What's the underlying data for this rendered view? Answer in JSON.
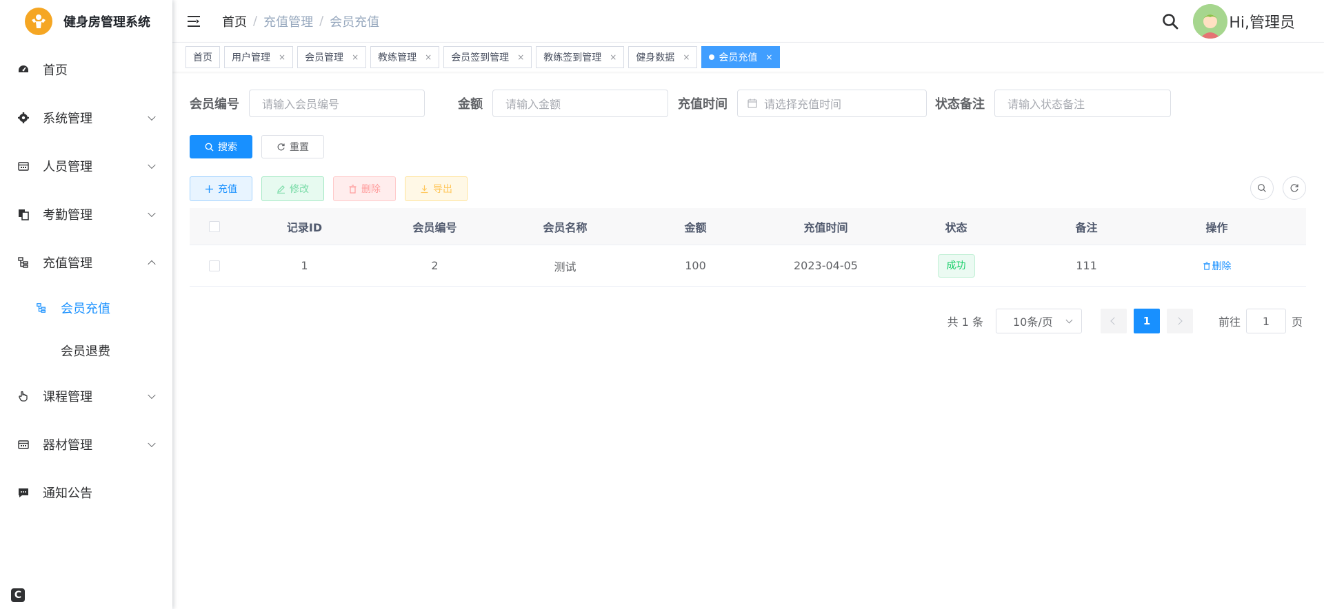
{
  "app": {
    "title": "健身房管理系统"
  },
  "sidebar": {
    "items": [
      {
        "label": "首页",
        "icon": "dashboard-icon"
      },
      {
        "label": "系统管理",
        "icon": "gear-icon"
      },
      {
        "label": "人员管理",
        "icon": "calendar-icon"
      },
      {
        "label": "考勤管理",
        "icon": "copy-icon"
      },
      {
        "label": "充值管理",
        "icon": "tree-icon",
        "expanded": true,
        "children": [
          {
            "label": "会员充值",
            "active": true
          },
          {
            "label": "会员退费"
          }
        ]
      },
      {
        "label": "课程管理",
        "icon": "hand-icon"
      },
      {
        "label": "器材管理",
        "icon": "calendar-icon"
      },
      {
        "label": "通知公告",
        "icon": "message-icon"
      }
    ]
  },
  "header": {
    "breadcrumb": [
      "首页",
      "充值管理",
      "会员充值"
    ],
    "breadcrumb_sep": "/",
    "greeting": "Hi,管理员"
  },
  "tags": [
    {
      "label": "首页",
      "closable": false
    },
    {
      "label": "用户管理",
      "closable": true
    },
    {
      "label": "会员管理",
      "closable": true
    },
    {
      "label": "教练管理",
      "closable": true
    },
    {
      "label": "会员签到管理",
      "closable": true
    },
    {
      "label": "教练签到管理",
      "closable": true
    },
    {
      "label": "健身数据",
      "closable": true
    },
    {
      "label": "会员充值",
      "closable": true,
      "active": true
    }
  ],
  "search": {
    "member_id_label": "会员编号",
    "member_id_placeholder": "请输入会员编号",
    "amount_label": "金额",
    "amount_placeholder": "请输入金额",
    "time_label": "充值时间",
    "time_placeholder": "请选择充值时间",
    "remark_label": "状态备注",
    "remark_placeholder": "请输入状态备注",
    "search_btn": "搜索",
    "reset_btn": "重置"
  },
  "toolbar": {
    "add": "充值",
    "edit": "修改",
    "delete": "删除",
    "export": "导出"
  },
  "table": {
    "columns": [
      "记录ID",
      "会员编号",
      "会员名称",
      "金额",
      "充值时间",
      "状态",
      "备注",
      "操作"
    ],
    "rows": [
      {
        "id": "1",
        "member_id": "2",
        "member_name": "测试",
        "amount": "100",
        "time": "2023-04-05",
        "status": "成功",
        "remark": "111",
        "action": "删除"
      }
    ]
  },
  "pagination": {
    "total": "共 1 条",
    "page_size": "10条/页",
    "current": "1",
    "goto_label": "前往",
    "goto_value": "1",
    "page_suffix": "页"
  },
  "colors": {
    "primary": "#1890ff",
    "success": "#13ce66",
    "logo": "#f5a623"
  }
}
